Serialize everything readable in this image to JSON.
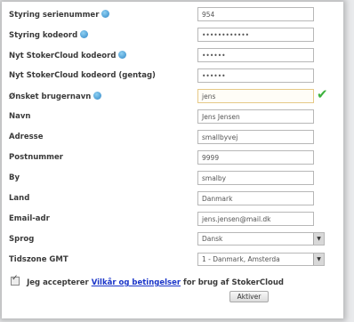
{
  "form": {
    "fields": [
      {
        "label": "Styring serienummer",
        "value": "954",
        "icon": "info-icon",
        "type": "text"
      },
      {
        "label": "Styring kodeord",
        "value": "••••••••••••",
        "icon": "info-icon",
        "type": "password"
      },
      {
        "label": "Nyt StokerCloud kodeord",
        "value": "••••••",
        "icon": "info-icon",
        "type": "password"
      },
      {
        "label": "Nyt StokerCloud kodeord (gentag)",
        "value": "••••••",
        "type": "password"
      },
      {
        "label": "Ønsket brugernavn",
        "value": "jens",
        "icon": "info-icon",
        "type": "text",
        "valid": true
      },
      {
        "label": "Navn",
        "value": "Jens Jensen",
        "type": "text"
      },
      {
        "label": "Adresse",
        "value": "smallbyvej",
        "type": "text"
      },
      {
        "label": "Postnummer",
        "value": "9999",
        "type": "text"
      },
      {
        "label": "By",
        "value": "smalby",
        "type": "text"
      },
      {
        "label": "Land",
        "value": "Danmark",
        "type": "text"
      },
      {
        "label": "Email-adr",
        "value": "jens.jensen@mail.dk",
        "type": "text"
      },
      {
        "label": "Sprog",
        "value": "Dansk",
        "type": "select"
      },
      {
        "label": "Tidszone GMT",
        "value": "1 - Danmark, Amsterda",
        "type": "select"
      }
    ],
    "accept": {
      "prefix": "Jeg accepterer",
      "link": "Vilkår og betingelser",
      "suffix": "for brug af StokerCloud",
      "checked": true
    },
    "submit_label": "Aktiver"
  },
  "colors": {
    "link": "#1a35c9",
    "valid_check": "#3db23d",
    "active_field_border": "#e6c987"
  }
}
